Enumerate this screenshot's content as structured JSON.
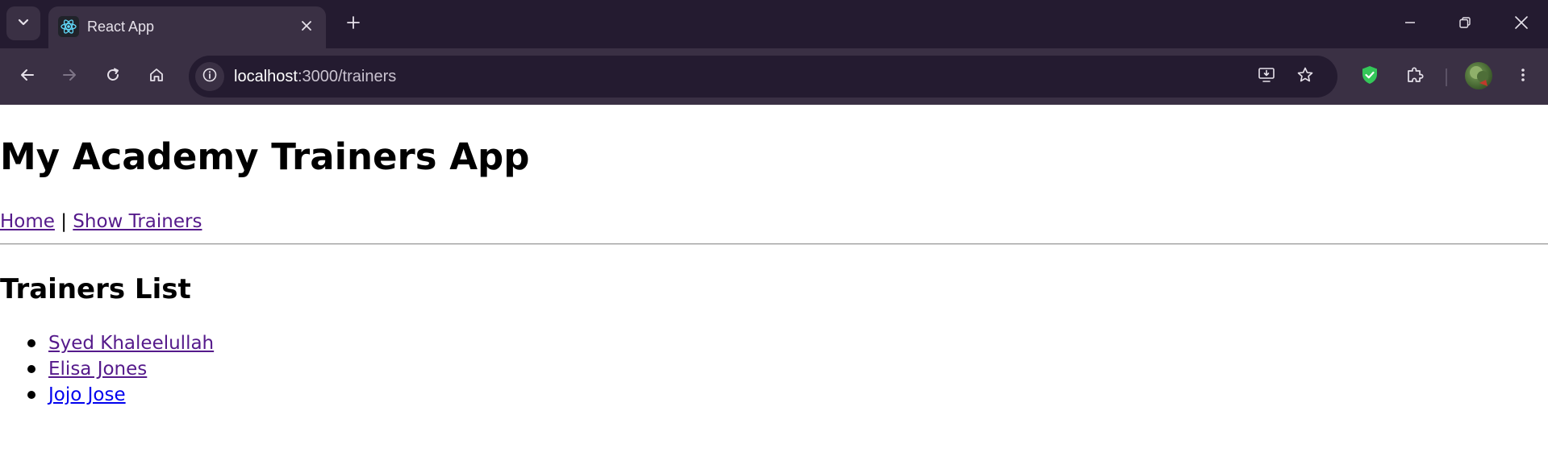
{
  "browser": {
    "tab": {
      "title": "React App",
      "favicon": "react-logo-icon"
    },
    "address_bar": {
      "host": "localhost",
      "path": ":3000/trainers"
    },
    "colors": {
      "titlebar": "#241b30",
      "toolbar": "#3a3044",
      "shield_accent": "#34c759"
    }
  },
  "page": {
    "app_title": "My Academy Trainers App",
    "nav": {
      "home_label": "Home",
      "separator": "|",
      "show_trainers_label": "Show Trainers"
    },
    "section_title": "Trainers List",
    "trainers": [
      {
        "name": "Syed Khaleelullah",
        "visited": true
      },
      {
        "name": "Elisa Jones",
        "visited": true
      },
      {
        "name": "Jojo Jose",
        "visited": false
      }
    ],
    "colors": {
      "visited_link": "#551a8b",
      "unvisited_link": "#0000ee"
    }
  }
}
